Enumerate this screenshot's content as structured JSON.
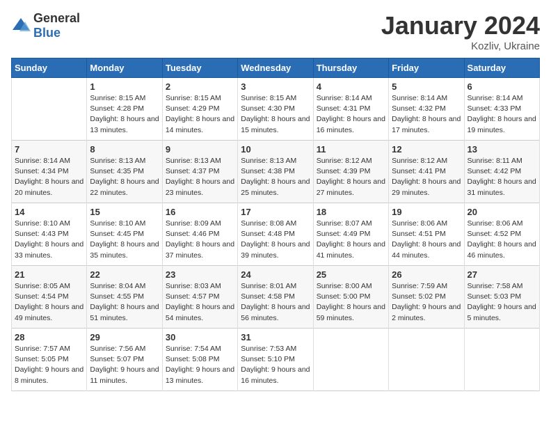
{
  "header": {
    "logo_general": "General",
    "logo_blue": "Blue",
    "month_year": "January 2024",
    "location": "Kozliv, Ukraine"
  },
  "weekdays": [
    "Sunday",
    "Monday",
    "Tuesday",
    "Wednesday",
    "Thursday",
    "Friday",
    "Saturday"
  ],
  "weeks": [
    [
      {
        "day": "",
        "sunrise": "",
        "sunset": "",
        "daylight": ""
      },
      {
        "day": "1",
        "sunrise": "Sunrise: 8:15 AM",
        "sunset": "Sunset: 4:28 PM",
        "daylight": "Daylight: 8 hours and 13 minutes."
      },
      {
        "day": "2",
        "sunrise": "Sunrise: 8:15 AM",
        "sunset": "Sunset: 4:29 PM",
        "daylight": "Daylight: 8 hours and 14 minutes."
      },
      {
        "day": "3",
        "sunrise": "Sunrise: 8:15 AM",
        "sunset": "Sunset: 4:30 PM",
        "daylight": "Daylight: 8 hours and 15 minutes."
      },
      {
        "day": "4",
        "sunrise": "Sunrise: 8:14 AM",
        "sunset": "Sunset: 4:31 PM",
        "daylight": "Daylight: 8 hours and 16 minutes."
      },
      {
        "day": "5",
        "sunrise": "Sunrise: 8:14 AM",
        "sunset": "Sunset: 4:32 PM",
        "daylight": "Daylight: 8 hours and 17 minutes."
      },
      {
        "day": "6",
        "sunrise": "Sunrise: 8:14 AM",
        "sunset": "Sunset: 4:33 PM",
        "daylight": "Daylight: 8 hours and 19 minutes."
      }
    ],
    [
      {
        "day": "7",
        "sunrise": "Sunrise: 8:14 AM",
        "sunset": "Sunset: 4:34 PM",
        "daylight": "Daylight: 8 hours and 20 minutes."
      },
      {
        "day": "8",
        "sunrise": "Sunrise: 8:13 AM",
        "sunset": "Sunset: 4:35 PM",
        "daylight": "Daylight: 8 hours and 22 minutes."
      },
      {
        "day": "9",
        "sunrise": "Sunrise: 8:13 AM",
        "sunset": "Sunset: 4:37 PM",
        "daylight": "Daylight: 8 hours and 23 minutes."
      },
      {
        "day": "10",
        "sunrise": "Sunrise: 8:13 AM",
        "sunset": "Sunset: 4:38 PM",
        "daylight": "Daylight: 8 hours and 25 minutes."
      },
      {
        "day": "11",
        "sunrise": "Sunrise: 8:12 AM",
        "sunset": "Sunset: 4:39 PM",
        "daylight": "Daylight: 8 hours and 27 minutes."
      },
      {
        "day": "12",
        "sunrise": "Sunrise: 8:12 AM",
        "sunset": "Sunset: 4:41 PM",
        "daylight": "Daylight: 8 hours and 29 minutes."
      },
      {
        "day": "13",
        "sunrise": "Sunrise: 8:11 AM",
        "sunset": "Sunset: 4:42 PM",
        "daylight": "Daylight: 8 hours and 31 minutes."
      }
    ],
    [
      {
        "day": "14",
        "sunrise": "Sunrise: 8:10 AM",
        "sunset": "Sunset: 4:43 PM",
        "daylight": "Daylight: 8 hours and 33 minutes."
      },
      {
        "day": "15",
        "sunrise": "Sunrise: 8:10 AM",
        "sunset": "Sunset: 4:45 PM",
        "daylight": "Daylight: 8 hours and 35 minutes."
      },
      {
        "day": "16",
        "sunrise": "Sunrise: 8:09 AM",
        "sunset": "Sunset: 4:46 PM",
        "daylight": "Daylight: 8 hours and 37 minutes."
      },
      {
        "day": "17",
        "sunrise": "Sunrise: 8:08 AM",
        "sunset": "Sunset: 4:48 PM",
        "daylight": "Daylight: 8 hours and 39 minutes."
      },
      {
        "day": "18",
        "sunrise": "Sunrise: 8:07 AM",
        "sunset": "Sunset: 4:49 PM",
        "daylight": "Daylight: 8 hours and 41 minutes."
      },
      {
        "day": "19",
        "sunrise": "Sunrise: 8:06 AM",
        "sunset": "Sunset: 4:51 PM",
        "daylight": "Daylight: 8 hours and 44 minutes."
      },
      {
        "day": "20",
        "sunrise": "Sunrise: 8:06 AM",
        "sunset": "Sunset: 4:52 PM",
        "daylight": "Daylight: 8 hours and 46 minutes."
      }
    ],
    [
      {
        "day": "21",
        "sunrise": "Sunrise: 8:05 AM",
        "sunset": "Sunset: 4:54 PM",
        "daylight": "Daylight: 8 hours and 49 minutes."
      },
      {
        "day": "22",
        "sunrise": "Sunrise: 8:04 AM",
        "sunset": "Sunset: 4:55 PM",
        "daylight": "Daylight: 8 hours and 51 minutes."
      },
      {
        "day": "23",
        "sunrise": "Sunrise: 8:03 AM",
        "sunset": "Sunset: 4:57 PM",
        "daylight": "Daylight: 8 hours and 54 minutes."
      },
      {
        "day": "24",
        "sunrise": "Sunrise: 8:01 AM",
        "sunset": "Sunset: 4:58 PM",
        "daylight": "Daylight: 8 hours and 56 minutes."
      },
      {
        "day": "25",
        "sunrise": "Sunrise: 8:00 AM",
        "sunset": "Sunset: 5:00 PM",
        "daylight": "Daylight: 8 hours and 59 minutes."
      },
      {
        "day": "26",
        "sunrise": "Sunrise: 7:59 AM",
        "sunset": "Sunset: 5:02 PM",
        "daylight": "Daylight: 9 hours and 2 minutes."
      },
      {
        "day": "27",
        "sunrise": "Sunrise: 7:58 AM",
        "sunset": "Sunset: 5:03 PM",
        "daylight": "Daylight: 9 hours and 5 minutes."
      }
    ],
    [
      {
        "day": "28",
        "sunrise": "Sunrise: 7:57 AM",
        "sunset": "Sunset: 5:05 PM",
        "daylight": "Daylight: 9 hours and 8 minutes."
      },
      {
        "day": "29",
        "sunrise": "Sunrise: 7:56 AM",
        "sunset": "Sunset: 5:07 PM",
        "daylight": "Daylight: 9 hours and 11 minutes."
      },
      {
        "day": "30",
        "sunrise": "Sunrise: 7:54 AM",
        "sunset": "Sunset: 5:08 PM",
        "daylight": "Daylight: 9 hours and 13 minutes."
      },
      {
        "day": "31",
        "sunrise": "Sunrise: 7:53 AM",
        "sunset": "Sunset: 5:10 PM",
        "daylight": "Daylight: 9 hours and 16 minutes."
      },
      {
        "day": "",
        "sunrise": "",
        "sunset": "",
        "daylight": ""
      },
      {
        "day": "",
        "sunrise": "",
        "sunset": "",
        "daylight": ""
      },
      {
        "day": "",
        "sunrise": "",
        "sunset": "",
        "daylight": ""
      }
    ]
  ]
}
